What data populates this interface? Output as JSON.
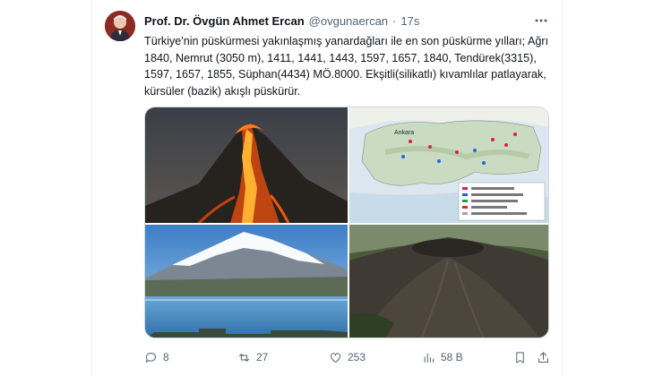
{
  "tweet": {
    "author_name": "Prof. Dr. Övgün Ahmet Ercan",
    "handle": "@ovgunaercan",
    "separator": "·",
    "time": "17s",
    "text": "Türkiye'nin püskürmesi yakınlaşmış yanardağları ile en son püskürme yılları; Ağrı 1840, Nemrut (3050 m), 1411, 1441, 1443, 1597, 1657, 1840, Tendürek(3315), 1597, 1657, 1855, Süphan(4434) MÖ.8000. Ekşitli(silikatlı) kıvamlılar patlayarak, kürsüler (bazik) akışlı püskürür.",
    "map_label": "Ankara"
  },
  "actions": {
    "replies": "8",
    "retweets": "27",
    "likes": "253",
    "views": "58 B"
  },
  "icons": {
    "more": "more-dots-icon",
    "reply": "reply-icon",
    "retweet": "retweet-icon",
    "like": "heart-icon",
    "views": "views-chart-icon",
    "bookmark": "bookmark-icon",
    "share": "share-icon"
  },
  "colors": {
    "text": "#0f1419",
    "secondary": "#536471",
    "border": "#cfd9de"
  }
}
